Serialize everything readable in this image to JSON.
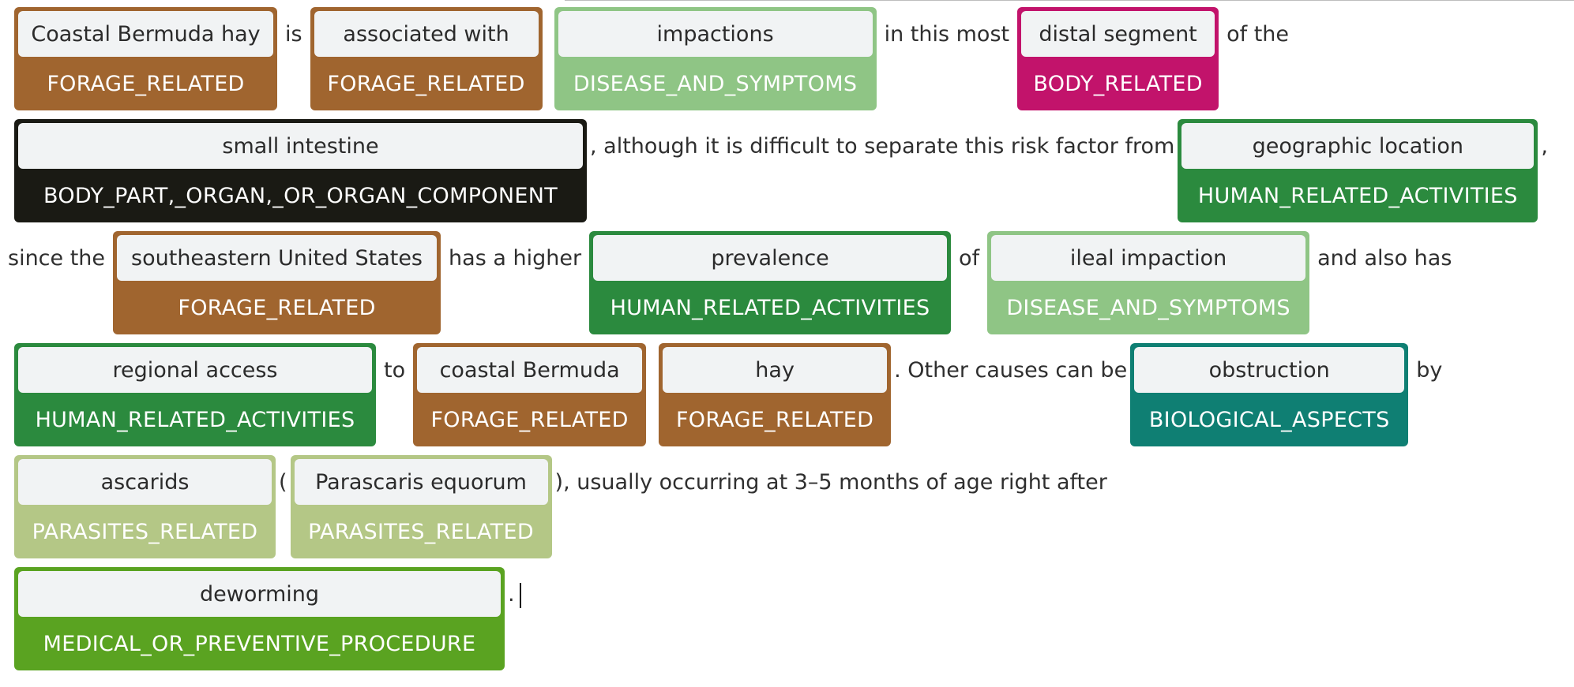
{
  "colors": {
    "FORAGE_RELATED": "#a0652f",
    "DISEASE_AND_SYMPTOMS": "#8fc585",
    "BODY_RELATED": "#c2136b",
    "BODY_PART_ORGAN_OR_ORGAN_COMPONENT": "#1a1a14",
    "HUMAN_RELATED_ACTIVITIES": "#2b8a3e",
    "BIOLOGICAL_ASPECTS": "#0f7f73",
    "PARASITES_RELATED": "#b4c786",
    "MEDICAL_OR_PREVENTIVE_PROCEDURE": "#5aa321"
  },
  "lines": [
    {
      "ent1": {
        "text": "Coastal Bermuda hay",
        "label": "FORAGE_RELATED"
      },
      "t1": "is",
      "ent2": {
        "text": "associated with",
        "label": "FORAGE_RELATED"
      },
      "ent3": {
        "text": "impactions",
        "label": "DISEASE_AND_SYMPTOMS"
      },
      "t2": "in this most",
      "ent4": {
        "text": "distal segment",
        "label": "BODY_RELATED"
      },
      "t3": "of the"
    },
    {
      "ent1": {
        "text": "small intestine",
        "label": "BODY_PART,_ORGAN,_OR_ORGAN_COMPONENT"
      },
      "t1": ", although it is difficult to separate this risk factor from",
      "ent2": {
        "text": "geographic location",
        "label": "HUMAN_RELATED_ACTIVITIES"
      },
      "t2": ","
    },
    {
      "t1": "since the",
      "ent1": {
        "text": "southeastern United States",
        "label": "FORAGE_RELATED"
      },
      "t2": "has a higher",
      "ent2": {
        "text": "prevalence",
        "label": "HUMAN_RELATED_ACTIVITIES"
      },
      "t3": "of",
      "ent3": {
        "text": "ileal impaction",
        "label": "DISEASE_AND_SYMPTOMS"
      },
      "t4": "and also has"
    },
    {
      "ent1": {
        "text": "regional access",
        "label": "HUMAN_RELATED_ACTIVITIES"
      },
      "t1": "to",
      "ent2": {
        "text": "coastal Bermuda",
        "label": "FORAGE_RELATED"
      },
      "ent3": {
        "text": "hay",
        "label": "FORAGE_RELATED"
      },
      "t2": ". Other causes can be",
      "ent4": {
        "text": "obstruction",
        "label": "BIOLOGICAL_ASPECTS"
      },
      "t3": "by"
    },
    {
      "ent1": {
        "text": "ascarids",
        "label": "PARASITES_RELATED"
      },
      "t1": "(",
      "ent2": {
        "text": "Parascaris equorum",
        "label": "PARASITES_RELATED"
      },
      "t2": "), usually occurring at 3–5 months of age right after"
    },
    {
      "ent1": {
        "text": "deworming",
        "label": "MEDICAL_OR_PREVENTIVE_PROCEDURE"
      },
      "t1": "."
    }
  ]
}
